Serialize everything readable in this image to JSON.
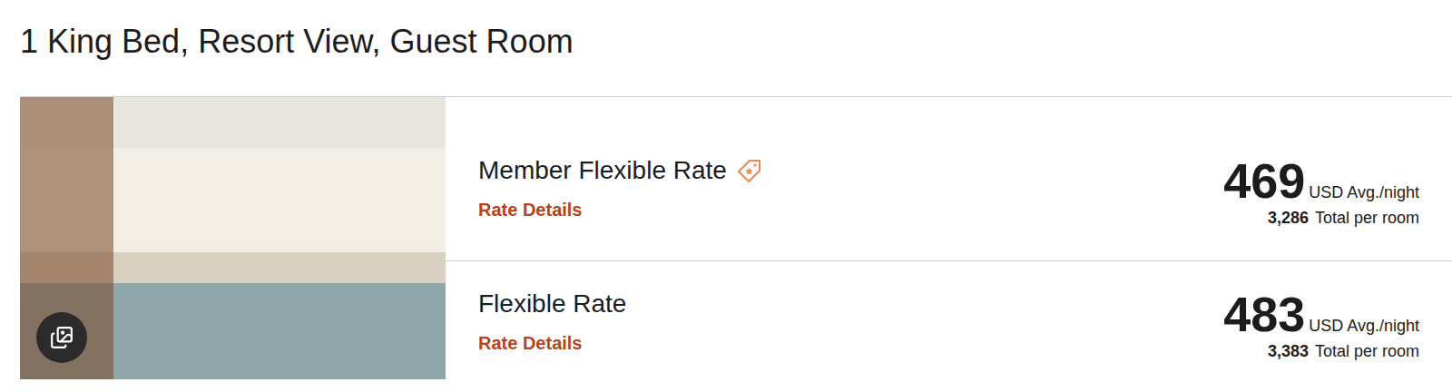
{
  "room": {
    "title": "1 King Bed, Resort View, Guest Room"
  },
  "rates": [
    {
      "name": "Member Flexible Rate",
      "member": true,
      "details": "Rate Details",
      "price": "469",
      "price_unit": "USD Avg./night",
      "total": "3,286",
      "total_label": "Total per room"
    },
    {
      "name": "Flexible Rate",
      "member": false,
      "details": "Rate Details",
      "price": "483",
      "price_unit": "USD Avg./night",
      "total": "3,383",
      "total_label": "Total per room"
    }
  ]
}
